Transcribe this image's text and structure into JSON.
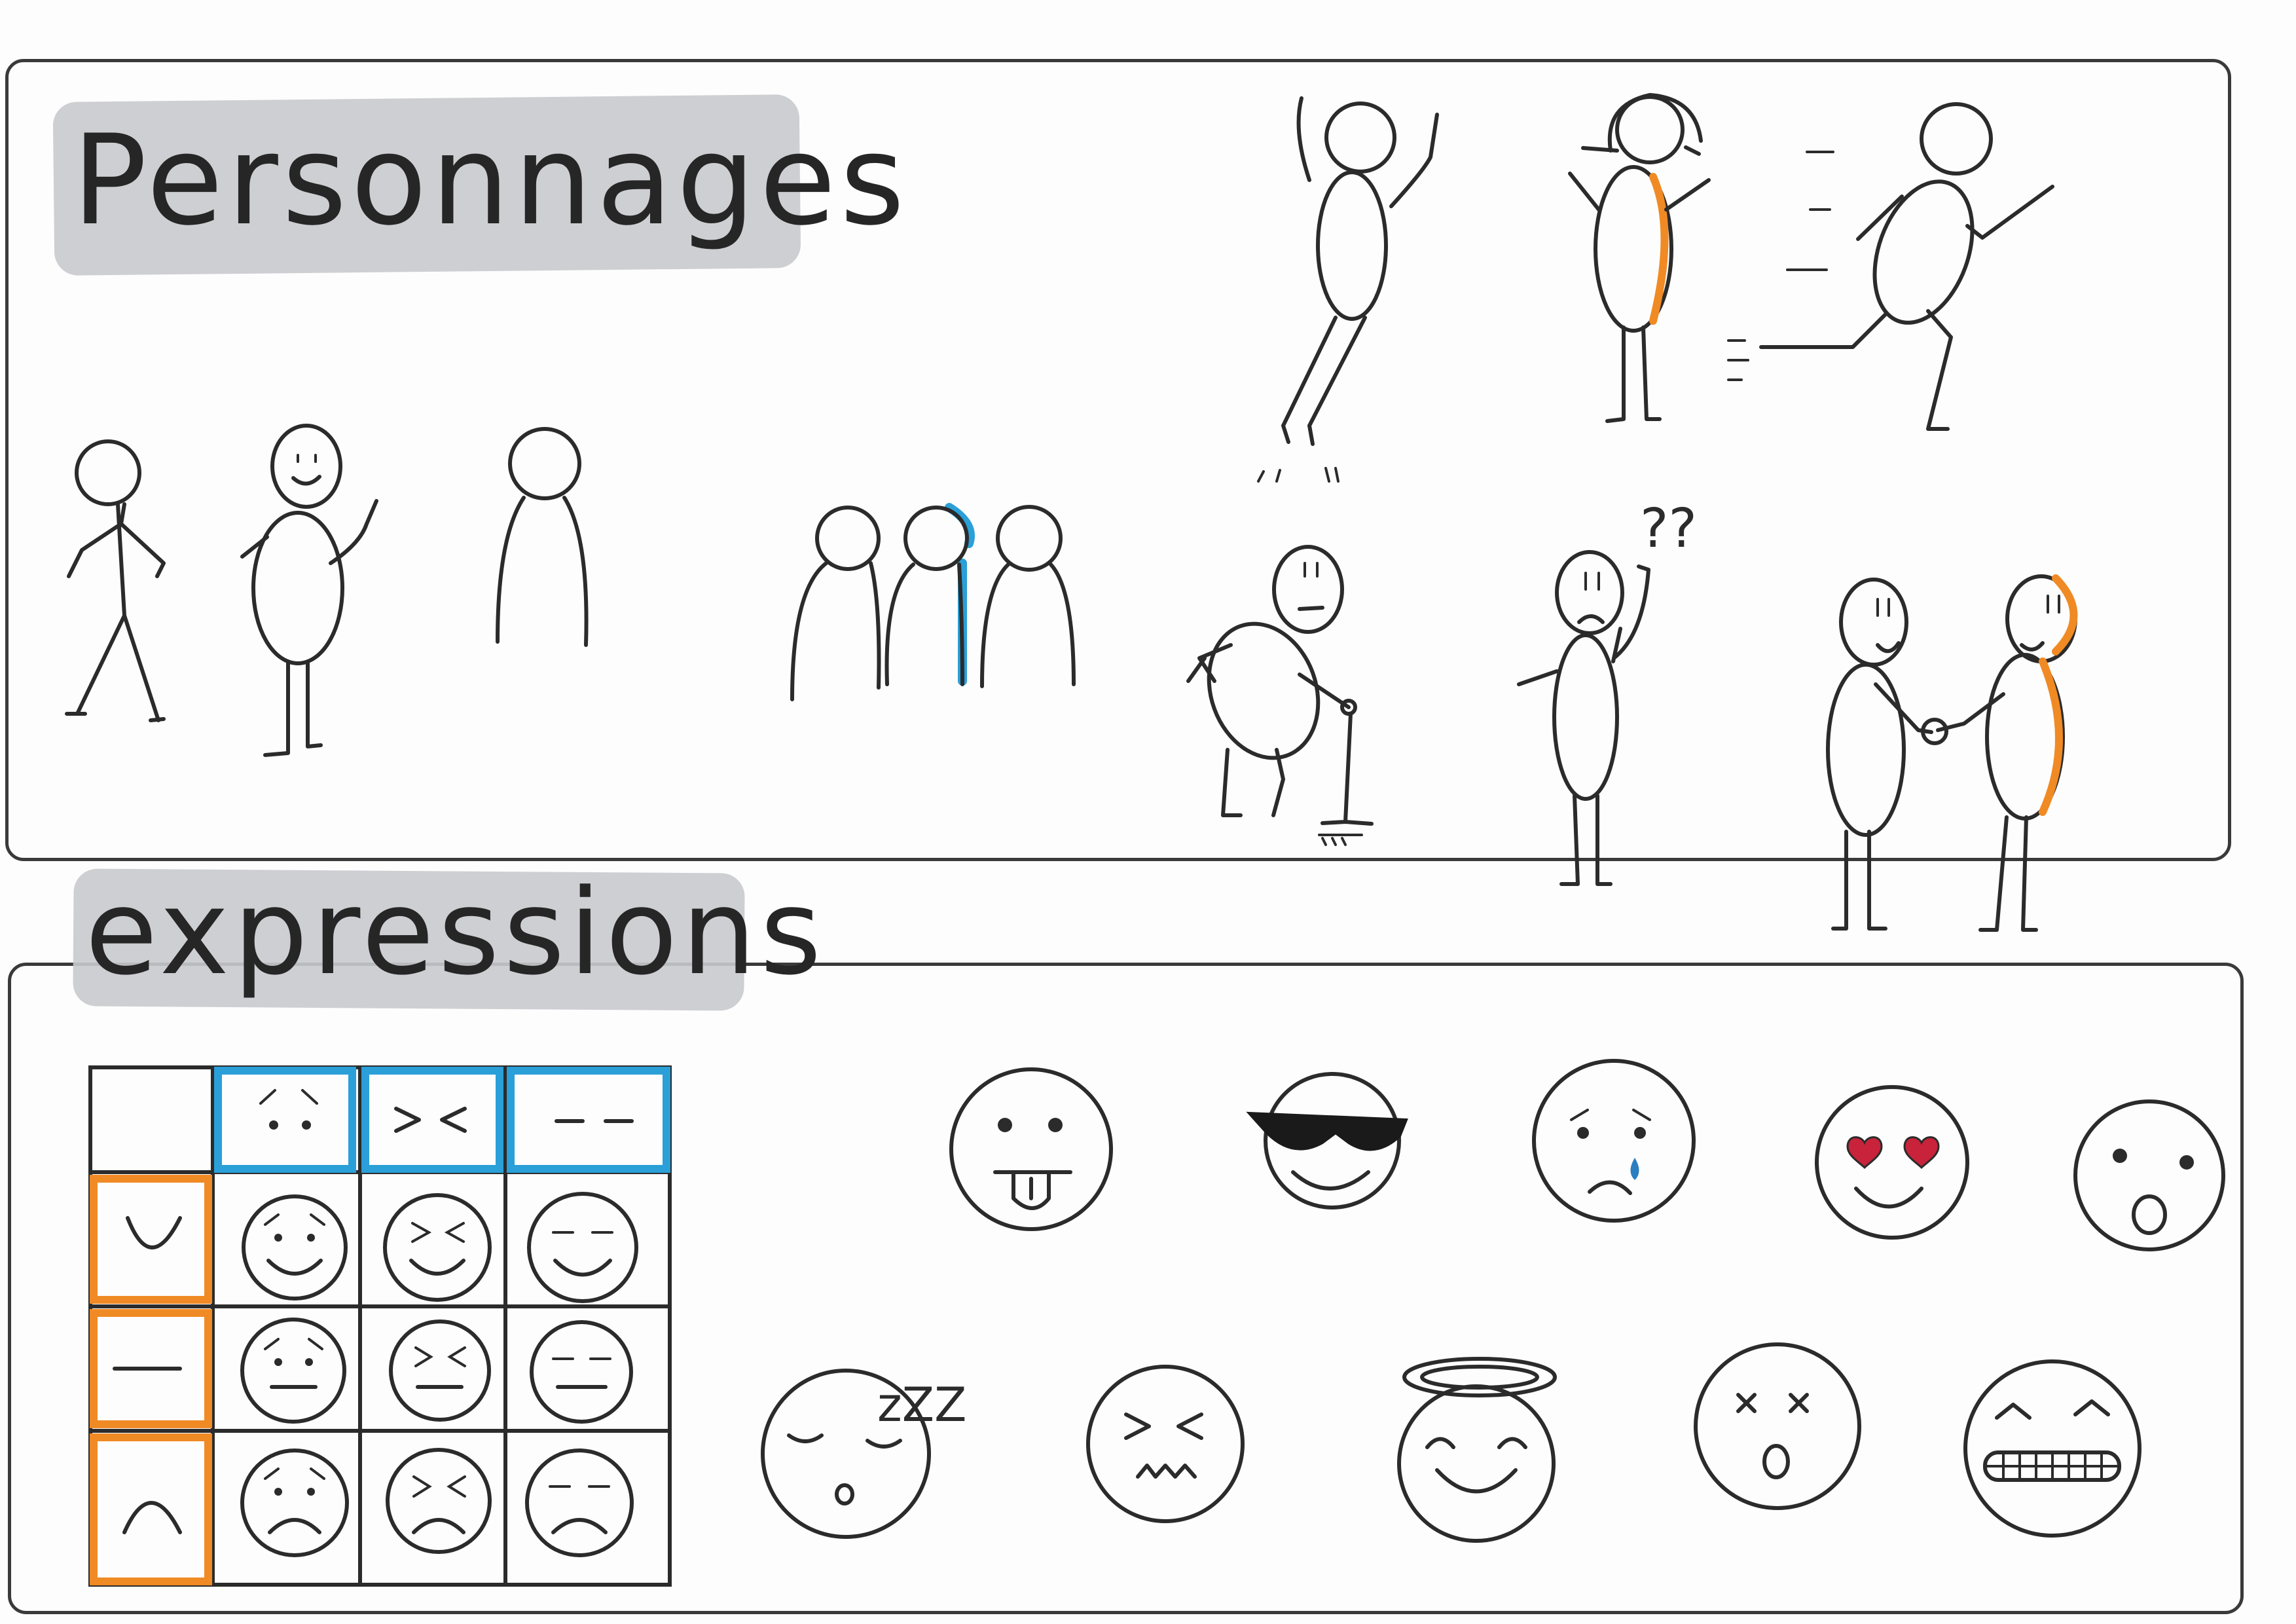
{
  "sections": {
    "characters_title": "Personnages",
    "expressions_title": "expressions"
  },
  "annotations": {
    "confused_marks": "??",
    "sleep_marks": "zZZ"
  },
  "colors": {
    "outline": "#2b2b2b",
    "title_highlight": "#c9cacd",
    "accent_orange": "#f08a24",
    "accent_blue": "#2a9fd8",
    "heart_red": "#c8233a"
  },
  "characters": [
    {
      "name": "stick-figure-walking-icon"
    },
    {
      "name": "bean-figure-waving-icon"
    },
    {
      "name": "head-torso-outline-icon"
    },
    {
      "name": "group-of-three-icon"
    },
    {
      "name": "jumping-figure-icon"
    },
    {
      "name": "figure-with-hair-icon"
    },
    {
      "name": "running-figure-icon"
    },
    {
      "name": "elderly-with-cane-icon"
    },
    {
      "name": "confused-figure-icon"
    },
    {
      "name": "handshake-pair-icon"
    }
  ],
  "expression_grid": {
    "columns": [
      "worried-eyes-icon",
      "squint-eyes-icon",
      "closed-eyes-icon"
    ],
    "rows": [
      "smile-mouth-icon",
      "flat-mouth-icon",
      "frown-mouth-icon"
    ]
  },
  "emojis": [
    {
      "name": "tongue-out-face-icon"
    },
    {
      "name": "sunglasses-face-icon"
    },
    {
      "name": "crying-face-icon"
    },
    {
      "name": "heart-eyes-face-icon"
    },
    {
      "name": "surprised-face-icon"
    },
    {
      "name": "sleeping-face-icon"
    },
    {
      "name": "sick-face-icon"
    },
    {
      "name": "angel-face-icon"
    },
    {
      "name": "dizzy-face-icon"
    },
    {
      "name": "grimacing-face-icon"
    }
  ]
}
